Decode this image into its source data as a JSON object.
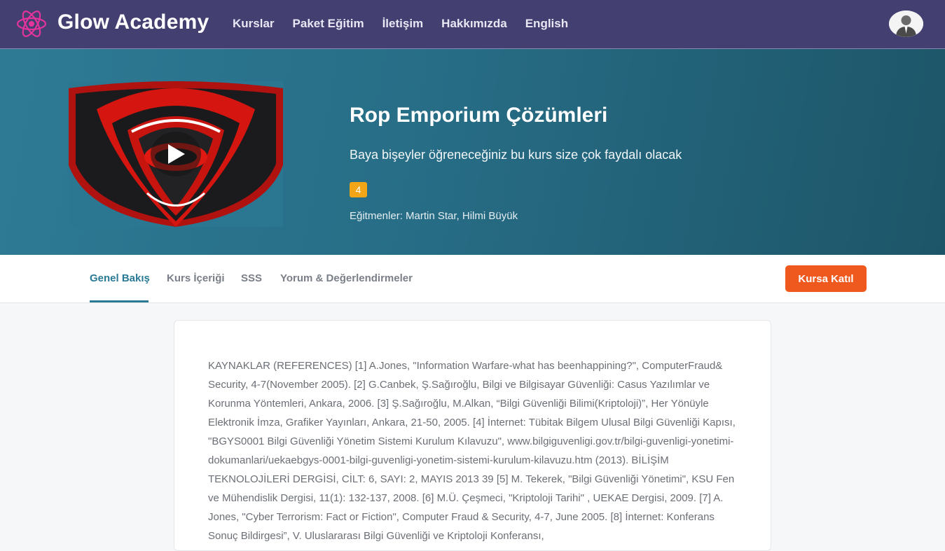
{
  "brand": {
    "name": "Glow Academy",
    "logo_icon": "atom-icon",
    "logo_color": "#e4339b"
  },
  "nav": {
    "items": [
      {
        "label": "Kurslar"
      },
      {
        "label": "Paket Eğitim"
      },
      {
        "label": "İletişim"
      },
      {
        "label": "Hakkımızda"
      },
      {
        "label": "English"
      }
    ]
  },
  "course": {
    "title": "Rop Emporium Çözümleri",
    "subtitle": "Baya bişeyler öğreneceğiniz bu kurs size çok faydalı olacak",
    "rating": "4",
    "instructors": "Eğitmenler: Martin Star, Hilmi Büyük"
  },
  "tabs": {
    "items": [
      {
        "label": "Genel Bakış",
        "active": true
      },
      {
        "label": "Kurs İçeriği",
        "active": false
      },
      {
        "label": "SSS",
        "active": false
      },
      {
        "label": "Yorum & Değerlendirmeler",
        "active": false
      }
    ],
    "join_label": "Kursa Katıl"
  },
  "content": {
    "text": "KAYNAKLAR (REFERENCES) [1] A.Jones, \"Information Warfare-what has beenhappining?\", ComputerFraud& Security, 4-7(November 2005). [2] G.Canbek, Ş.Sağıroğlu, Bilgi ve Bilgisayar Güvenliği: Casus Yazılımlar ve Korunma Yöntemleri, Ankara, 2006. [3] Ş.Sağıroğlu, M.Alkan, “Bilgi Güvenliği Bilimi(Kriptoloji)”, Her Yönüyle Elektronik İmza, Grafiker Yayınları, Ankara, 21-50, 2005. [4] İnternet: Tübitak Bilgem Ulusal Bilgi Güvenliği Kapısı, \"BGYS0001 Bilgi Güvenliği Yönetim Sistemi Kurulum Kılavuzu\", www.bilgiguvenligi.gov.tr/bilgi-guvenligi-yonetimi-dokumanlari/uekaebgys-0001-bilgi-guvenligi-yonetim-sistemi-kurulum-kilavuzu.htm (2013). BİLİŞİM TEKNOLOJİLERİ DERGİSİ, CİLT: 6, SAYI: 2, MAYIS 2013 39 [5] M. Tekerek, \"Bilgi Güvenliği Yönetimi\", KSU Fen ve Mühendislik Dergisi, 11(1): 132-137, 2008. [6] M.Ü. Çeşmeci, \"Kriptoloji Tarihi\" , UEKAE Dergisi, 2009. [7] A. Jones, \"Cyber Terrorism: Fact or Fiction\", Computer Fraud & Security, 4-7, June 2005. [8] İnternet: Konferans Sonuç Bildirgesi”, V. Uluslararası Bilgi Güvenliği ve Kriptoloji Konferansı,"
  },
  "colors": {
    "navbar": "#433f71",
    "hero_start": "#2e7a95",
    "hero_end": "#1d5568",
    "accent_tab": "#2a7a96",
    "cta": "#f0591e",
    "rating_badge": "#f2a516"
  }
}
